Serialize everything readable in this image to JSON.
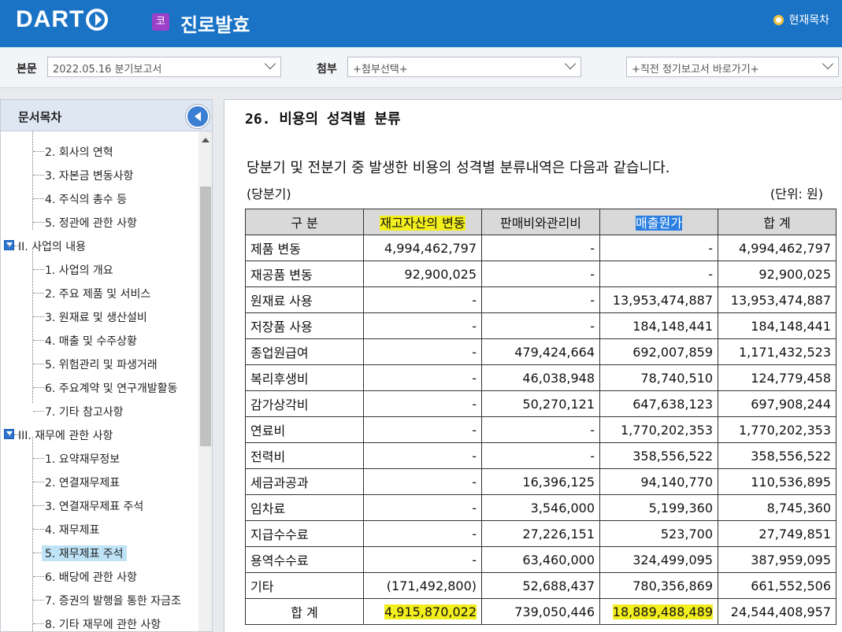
{
  "header": {
    "logo": "DART",
    "company_badge": "코",
    "company_name": "진로발효",
    "toc_link": "현재목차"
  },
  "selectbar": {
    "main_label": "본문",
    "main_value": "2022.05.16  분기보고서",
    "attach_label": "첨부",
    "attach_value": "+첨부선택+",
    "prev_value": "+직전 정기보고서 바로가기+"
  },
  "sidebar": {
    "title": "문서목차",
    "items": [
      {
        "text": "2. 회사의 연혁",
        "level": 2
      },
      {
        "text": "3. 자본금 변동사항",
        "level": 2
      },
      {
        "text": "4. 주식의 총수 등",
        "level": 2
      },
      {
        "text": "5. 정관에 관한 사항",
        "level": 2
      },
      {
        "text": "II. 사업의 내용",
        "level": 1
      },
      {
        "text": "1. 사업의 개요",
        "level": 2
      },
      {
        "text": "2. 주요 제품 및 서비스",
        "level": 2
      },
      {
        "text": "3. 원재료 및 생산설비",
        "level": 2
      },
      {
        "text": "4. 매출 및 수주상황",
        "level": 2
      },
      {
        "text": "5. 위험관리 및 파생거래",
        "level": 2
      },
      {
        "text": "6. 주요계약 및 연구개발활동",
        "level": 2
      },
      {
        "text": "7. 기타 참고사항",
        "level": 2
      },
      {
        "text": "III. 재무에 관한 사항",
        "level": 1
      },
      {
        "text": "1. 요약재무정보",
        "level": 2
      },
      {
        "text": "2. 연결재무제표",
        "level": 2
      },
      {
        "text": "3. 연결재무제표 주석",
        "level": 2
      },
      {
        "text": "4. 재무제표",
        "level": 2
      },
      {
        "text": "5. 재무제표 주석",
        "level": 2,
        "selected": true
      },
      {
        "text": "6. 배당에 관한 사항",
        "level": 2
      },
      {
        "text": "7. 증권의 발행을 통한 자금조",
        "level": 2
      },
      {
        "text": "8. 기타 재무에 관한 사항",
        "level": 2
      }
    ]
  },
  "content": {
    "section_title": "26. 비용의 성격별 분류",
    "description": "당분기 및 전분기 중 발생한 비용의 성격별 분류내역은 다음과 같습니다.",
    "period": "(당분기)",
    "unit": "(단위: 원)",
    "table": {
      "headers": [
        "구 분",
        "재고자산의 변동",
        "판매비와관리비",
        "매출원가",
        "합 계"
      ],
      "rows": [
        [
          "제품 변동",
          "4,994,462,797",
          "-",
          "-",
          "4,994,462,797"
        ],
        [
          "재공품 변동",
          "92,900,025",
          "-",
          "-",
          "92,900,025"
        ],
        [
          "원재료 사용",
          "-",
          "-",
          "13,953,474,887",
          "13,953,474,887"
        ],
        [
          "저장품 사용",
          "-",
          "-",
          "184,148,441",
          "184,148,441"
        ],
        [
          "종업원급여",
          "-",
          "479,424,664",
          "692,007,859",
          "1,171,432,523"
        ],
        [
          "복리후생비",
          "-",
          "46,038,948",
          "78,740,510",
          "124,779,458"
        ],
        [
          "감가상각비",
          "-",
          "50,270,121",
          "647,638,123",
          "697,908,244"
        ],
        [
          "연료비",
          "-",
          "-",
          "1,770,202,353",
          "1,770,202,353"
        ],
        [
          "전력비",
          "-",
          "-",
          "358,556,522",
          "358,556,522"
        ],
        [
          "세금과공과",
          "-",
          "16,396,125",
          "94,140,770",
          "110,536,895"
        ],
        [
          "임차료",
          "-",
          "3,546,000",
          "5,199,360",
          "8,745,360"
        ],
        [
          "지급수수료",
          "-",
          "27,226,151",
          "523,700",
          "27,749,851"
        ],
        [
          "용역수수료",
          "-",
          "63,460,000",
          "324,499,095",
          "387,959,095"
        ],
        [
          "기타",
          "(171,492,800)",
          "52,688,437",
          "780,356,869",
          "661,552,506"
        ]
      ],
      "total": [
        "합 계",
        "4,915,870,022",
        "739,050,446",
        "18,889,488,489",
        "24,544,408,957"
      ]
    },
    "highlight_yellow": "#f3ee1d",
    "highlight_blue": "#2b7fe0"
  }
}
